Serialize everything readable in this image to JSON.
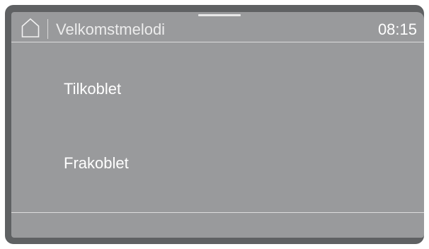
{
  "status_bar": {
    "home_icon": "home-icon",
    "title": "Velkomstmelodi",
    "time": "08:15"
  },
  "options": [
    {
      "label": "Tilkoblet"
    },
    {
      "label": "Frakoblet"
    }
  ],
  "colors": {
    "bezel": "#5f6163",
    "screen": "#999a9c",
    "text": "#ffffff",
    "divider": "#dcdcdc"
  }
}
